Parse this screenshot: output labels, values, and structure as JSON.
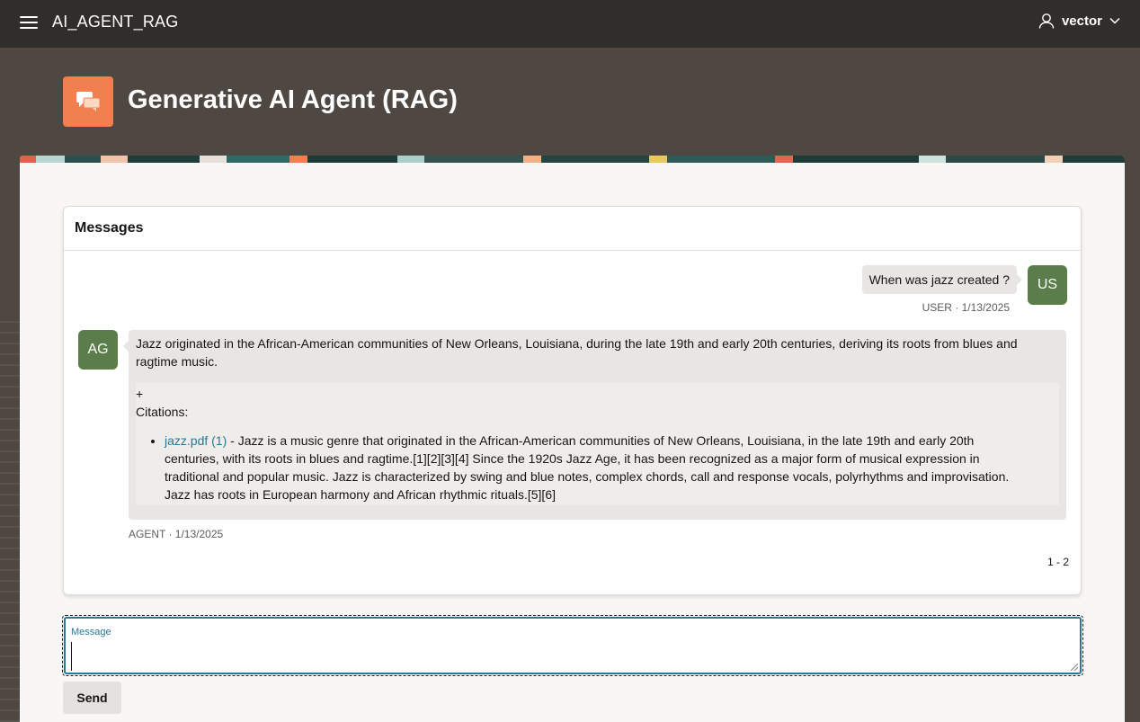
{
  "header": {
    "app_title": "AI_AGENT_RAG",
    "user_name": "vector"
  },
  "hero": {
    "page_title": "Generative AI Agent (RAG)",
    "icon": "chat-bubbles-icon"
  },
  "messages_card": {
    "title": "Messages",
    "messages": [
      {
        "role": "user",
        "avatar": "US",
        "text": "When was jazz created ?",
        "meta": "USER · 1/13/2025"
      },
      {
        "role": "agent",
        "avatar": "AG",
        "text": "Jazz originated in the African-American communities of New Orleans, Louisiana, during the late 19th and early 20th centuries, deriving its roots from blues and ragtime music.",
        "citations_plus": "+",
        "citations_label": "Citations:",
        "citation_link": "jazz.pdf (1)",
        "citation_text": " - Jazz is a music genre that originated in the African-American communities of New Orleans, Louisiana, in the late 19th and early 20th centuries, with its roots in blues and ragtime.[1][2][3][4] Since the 1920s Jazz Age, it has been recognized as a major form of musical expression in traditional and popular music. Jazz is characterized by swing and blue notes, complex chords, call and response vocals, polyrhythms and improvisation. Jazz has roots in European harmony and African rhythmic rituals.[5][6]",
        "meta": "AGENT · 1/13/2025"
      }
    ],
    "pagination": "1 - 2"
  },
  "composer": {
    "label": "Message",
    "value": "",
    "send_label": "Send"
  },
  "colors": {
    "topbar": "#312d2a",
    "hero": "#4f4842",
    "accent": "#2a7895",
    "avatar": "#5b7d4b",
    "app_icon": "#f0804f"
  }
}
